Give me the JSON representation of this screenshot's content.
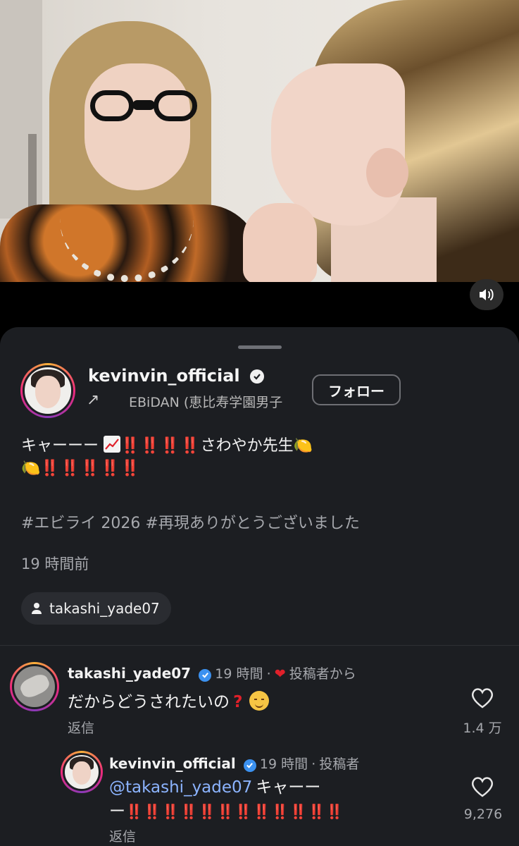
{
  "post": {
    "username": "kevinvin_official",
    "music_text": "EBiDAN (恵比寿学園男子",
    "follow_label": "フォロー",
    "caption_line1_a": "キャーーー",
    "caption_line1_b": "さわやか先生",
    "caption_bangs_1": "‼️‼️‼️‼️",
    "caption_bangs_2": "‼️‼️‼️‼️‼️",
    "hashtags": "#エビライ 2026 #再現ありがとうございました",
    "time": "19 時間前",
    "tagged_user": "takashi_yade07"
  },
  "comments": [
    {
      "username": "takashi_yade07",
      "time": "19 時間",
      "meta_suffix": "投稿者から",
      "text": "だからどうされたいの",
      "reply_label": "返信",
      "likes": "1.4 万"
    },
    {
      "username": "kevinvin_official",
      "time": "19 時間",
      "meta_suffix": "投稿者",
      "mention": "@takashi_yade07",
      "text_a": "キャーー",
      "text_b": "ー",
      "bangs": "‼️‼️‼️‼️‼️‼️‼️‼️‼️‼️‼️‼️",
      "reply_label": "返信",
      "likes": "9,276"
    }
  ],
  "icons": {
    "sound": "speaker-icon",
    "verified": "verified-badge-icon",
    "music_arrow": "arrow-icon",
    "tag": "person-icon",
    "like": "heart-icon"
  },
  "colors": {
    "sheet_bg": "#1c1e22",
    "accent_red": "#e0202a",
    "verified_blue": "#3b91f0",
    "mention": "#8cb4ff"
  }
}
